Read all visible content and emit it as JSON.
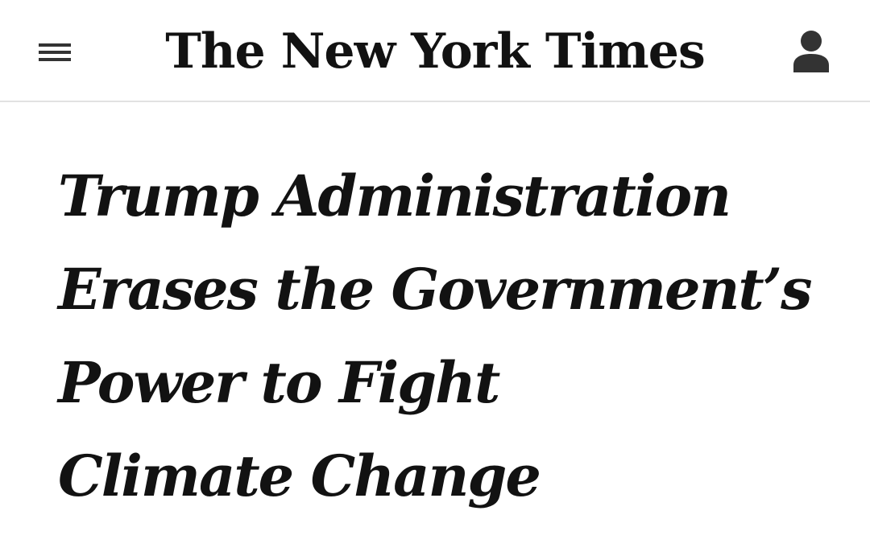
{
  "header": {
    "menu_icon": "hamburger-menu-icon",
    "masthead": "The New York Times",
    "account_icon": "user-account-icon"
  },
  "article": {
    "headline_lines": [
      "Trump Administration",
      "Erases the Government’s",
      "Power to Fight",
      "Climate Change"
    ]
  },
  "colors": {
    "text": "#121212",
    "background": "#ffffff",
    "divider": "#e2e2e2",
    "icon": "#333333"
  }
}
